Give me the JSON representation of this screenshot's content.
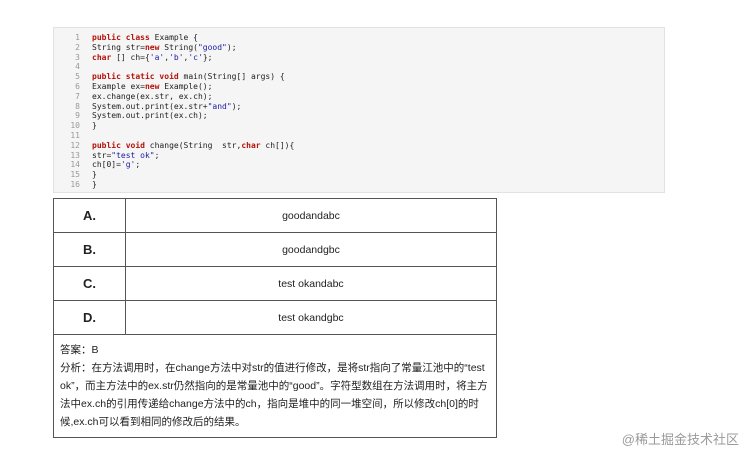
{
  "code": {
    "lines": [
      {
        "n": "1",
        "segments": [
          {
            "t": "public class ",
            "k": "kw"
          },
          {
            "t": "Example {",
            "k": ""
          }
        ]
      },
      {
        "n": "2",
        "segments": [
          {
            "t": "String str=",
            "k": ""
          },
          {
            "t": "new",
            "k": "kw"
          },
          {
            "t": " String(",
            "k": ""
          },
          {
            "t": "\"good\"",
            "k": "str"
          },
          {
            "t": ");",
            "k": ""
          }
        ]
      },
      {
        "n": "3",
        "segments": [
          {
            "t": "char",
            "k": "kw"
          },
          {
            "t": " [] ch={",
            "k": ""
          },
          {
            "t": "'a'",
            "k": "str"
          },
          {
            "t": ",",
            "k": ""
          },
          {
            "t": "'b'",
            "k": "str"
          },
          {
            "t": ",",
            "k": ""
          },
          {
            "t": "'c'",
            "k": "str"
          },
          {
            "t": "};",
            "k": ""
          }
        ]
      },
      {
        "n": "4",
        "segments": []
      },
      {
        "n": "5",
        "segments": [
          {
            "t": "public static void",
            "k": "kw"
          },
          {
            "t": " main(String[] args) {",
            "k": ""
          }
        ]
      },
      {
        "n": "6",
        "segments": [
          {
            "t": "Example ex=",
            "k": ""
          },
          {
            "t": "new",
            "k": "kw"
          },
          {
            "t": " Example();",
            "k": ""
          }
        ]
      },
      {
        "n": "7",
        "segments": [
          {
            "t": "ex.change(ex.str, ex.ch);",
            "k": ""
          }
        ]
      },
      {
        "n": "8",
        "segments": [
          {
            "t": "System.out.print(ex.str+",
            "k": ""
          },
          {
            "t": "\"and\"",
            "k": "str"
          },
          {
            "t": ");",
            "k": ""
          }
        ]
      },
      {
        "n": "9",
        "segments": [
          {
            "t": "System.out.print(ex.ch);",
            "k": ""
          }
        ]
      },
      {
        "n": "10",
        "segments": [
          {
            "t": "}",
            "k": ""
          }
        ]
      },
      {
        "n": "11",
        "segments": []
      },
      {
        "n": "12",
        "segments": [
          {
            "t": "public void",
            "k": "kw"
          },
          {
            "t": " change(String  str,",
            "k": ""
          },
          {
            "t": "char",
            "k": "kw"
          },
          {
            "t": " ch[]){",
            "k": ""
          }
        ]
      },
      {
        "n": "13",
        "segments": [
          {
            "t": "str=",
            "k": ""
          },
          {
            "t": "\"test ok\"",
            "k": "str"
          },
          {
            "t": ";",
            "k": ""
          }
        ]
      },
      {
        "n": "14",
        "segments": [
          {
            "t": "ch[0]=",
            "k": ""
          },
          {
            "t": "'g'",
            "k": "str"
          },
          {
            "t": ";",
            "k": ""
          }
        ]
      },
      {
        "n": "15",
        "segments": [
          {
            "t": "}",
            "k": ""
          }
        ]
      },
      {
        "n": "16",
        "segments": [
          {
            "t": "}",
            "k": ""
          }
        ]
      }
    ]
  },
  "options": [
    {
      "letter": "A.",
      "text": "goodandabc"
    },
    {
      "letter": "B.",
      "text": "goodandgbc"
    },
    {
      "letter": "C.",
      "text": "test okandabc"
    },
    {
      "letter": "D.",
      "text": "test okandgbc"
    }
  ],
  "answer": "答案：B",
  "analysis": "分析：在方法调用时，在change方法中对str的值进行修改，是将str指向了常量江池中的“test ok”，而主方法中的ex.str仍然指向的是常量池中的“good”。字符型数组在方法调用时，将主方法中ex.ch的引用传递给change方法中的ch，指向是堆中的同一堆空间，所以修改ch[0]的时候,ex.ch可以看到相同的修改后的结果。",
  "watermark": "@稀土掘金技术社区"
}
